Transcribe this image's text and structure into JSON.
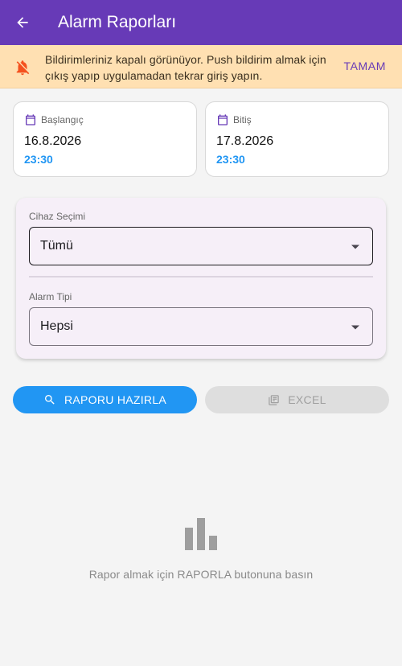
{
  "appbar": {
    "title": "Alarm Raporları",
    "back_icon": "arrow-back-icon"
  },
  "banner": {
    "message": "Bildirimleriniz kapalı görünüyor. Push bildirim almak için çıkış yapıp uygulamadan tekrar giriş yapın.",
    "action": "TAMAM",
    "icon": "notifications-off-icon",
    "background": "#ffe0b2",
    "icon_color": "#f4511e"
  },
  "dates": {
    "start": {
      "label": "Başlangıç",
      "date": "16.8.2026",
      "time": "23:30"
    },
    "end": {
      "label": "Bitiş",
      "date": "17.8.2026",
      "time": "23:30"
    }
  },
  "filters": {
    "device": {
      "label": "Cihaz Seçimi",
      "value": "Tümü"
    },
    "alarm_type": {
      "label": "Alarm Tipi",
      "value": "Hepsi"
    }
  },
  "actions": {
    "report": {
      "label": "RAPORU HAZIRLA",
      "icon": "search-icon",
      "enabled": true
    },
    "excel": {
      "label": "EXCEL",
      "icon": "table-icon",
      "enabled": false
    }
  },
  "empty_state": {
    "icon": "bar-chart-icon",
    "message": "Rapor almak için RAPORLA butonuna basın"
  },
  "colors": {
    "primary": "#673ab7",
    "accent": "#2196f3",
    "background": "#f4f4f4"
  }
}
